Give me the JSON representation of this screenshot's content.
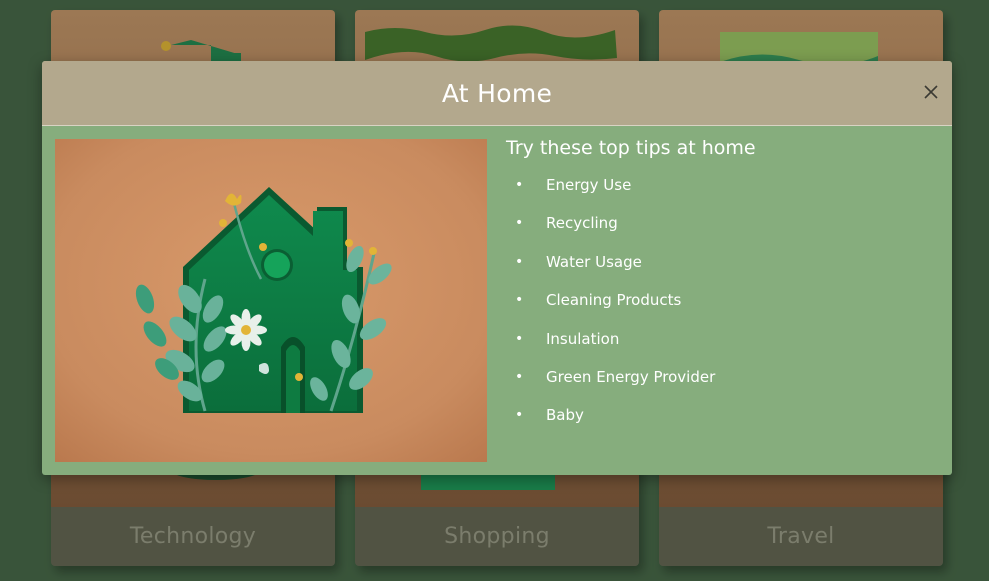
{
  "cards": [
    {
      "label": "Technology"
    },
    {
      "label": "Shopping"
    },
    {
      "label": "Travel"
    }
  ],
  "modal": {
    "title": "At Home",
    "close_icon": "close-icon",
    "heading": "Try these top tips at home",
    "tips": [
      "Energy Use",
      "Recycling",
      "Water Usage",
      "Cleaning Products",
      "Insulation",
      "Green Energy Provider",
      "Baby"
    ]
  },
  "colors": {
    "page_background": "#3e5a3f",
    "modal_header": "#b3a88d",
    "modal_body": "#86ad7d",
    "card_footer": "#5b584a",
    "paper_green": "#1f9a5a",
    "kraft": "#c98b5f"
  }
}
